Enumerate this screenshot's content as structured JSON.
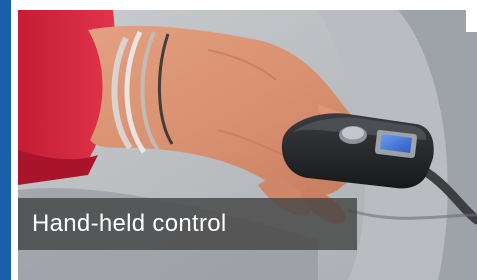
{
  "card": {
    "caption": "Hand-held control",
    "accent_color": "#1a5fa8",
    "caption_bg": "#464646"
  },
  "photo": {
    "subject": "hand-held-pendant-controller"
  }
}
